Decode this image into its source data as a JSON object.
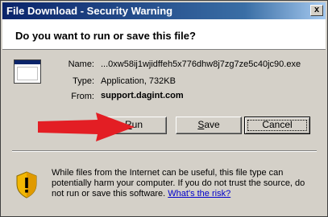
{
  "window": {
    "title": "File Download - Security Warning",
    "close_glyph": "x"
  },
  "header": {
    "question": "Do you want to run or save this file?"
  },
  "file": {
    "icon": "application-window-icon",
    "name_label": "Name:",
    "name_value": "...0xw58ij1wjidffeh5x776dhw8j7zg7ze5c40jc90.exe",
    "type_label": "Type:",
    "type_value": "Application, 732KB",
    "from_label": "From:",
    "from_value": "support.dagint.com"
  },
  "buttons": {
    "run": {
      "mnemonic": "R",
      "rest": "un"
    },
    "save": {
      "mnemonic": "S",
      "rest": "ave"
    },
    "cancel": "Cancel"
  },
  "annotation": {
    "icon": "red-arrow-icon",
    "color": "#e31e24"
  },
  "warning": {
    "icon": "security-shield-icon",
    "text": "While files from the Internet can be useful, this file type can potentially harm your computer. If you do not trust the source, do not run or save this software. ",
    "link": "What's the risk?"
  },
  "colors": {
    "titlebar_start": "#0a246a",
    "titlebar_end": "#a6caf0",
    "dialog_face": "#d4d0c8",
    "link": "#0000cc"
  }
}
